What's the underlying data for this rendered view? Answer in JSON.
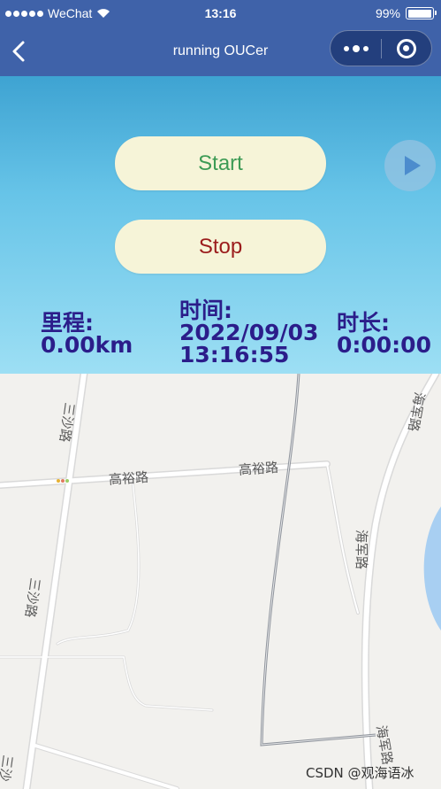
{
  "status_bar": {
    "carrier": "WeChat",
    "time": "13:16",
    "battery": "99%",
    "battery_level": 0.99
  },
  "nav": {
    "title": "running OUCer"
  },
  "controls": {
    "start_label": "Start",
    "stop_label": "Stop"
  },
  "stats": {
    "distance_label": "里程:",
    "distance_value": "0.00km",
    "time_label": "时间:",
    "time_date": "2022/09/03",
    "time_clock": "13:16:55",
    "duration_label": "时长:",
    "duration_value": "0:00:00"
  },
  "map": {
    "road_labels": [
      "高裕路",
      "高裕路",
      "三沙路",
      "三沙路",
      "海军路",
      "海军路",
      "海军路",
      "三沙"
    ]
  },
  "watermark": "CSDN @观海语冰",
  "colors": {
    "header": "#3f62a9",
    "start_text": "#3d9b55",
    "stop_text": "#9b1c1c",
    "stats_text": "#2b1d8a",
    "button_bg": "#f6f4d8"
  }
}
